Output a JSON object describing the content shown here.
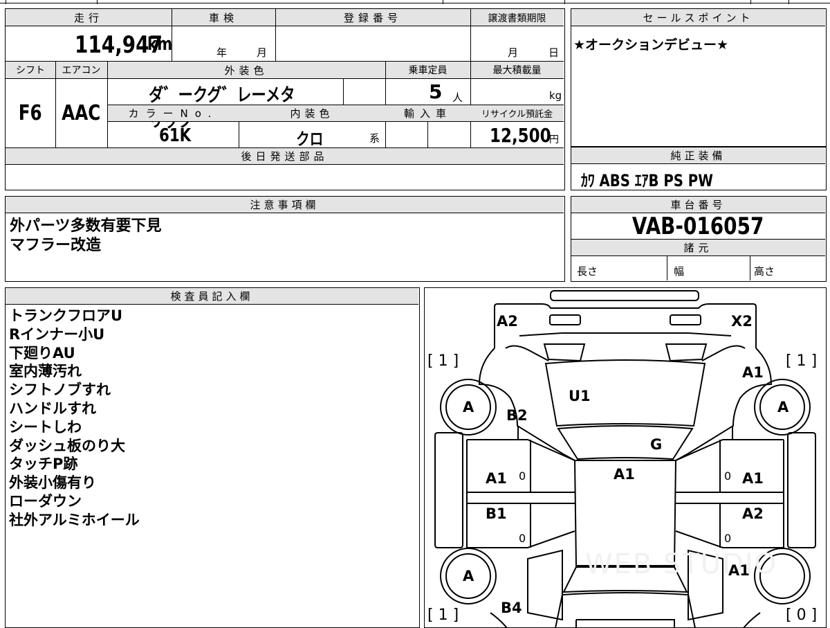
{
  "info": {
    "mileage_label": "走行",
    "mileage_value": "114,947",
    "mileage_unit": "km",
    "inspection_label": "車検",
    "inspection_year": "年",
    "inspection_month": "月",
    "registration_label": "登録番号",
    "transfer_label": "譲渡書類期限",
    "transfer_month": "月",
    "transfer_day": "日",
    "shift_label": "シフト",
    "shift_value": "F6",
    "aircon_label": "エアコン",
    "aircon_value": "AAC",
    "exterior_color_label": "外装色",
    "exterior_color_value": "ダ゛ークグ゛レーメタリック",
    "capacity_label": "乗車定員",
    "capacity_value": "5",
    "capacity_unit": "人",
    "max_load_label": "最大積載量",
    "max_load_unit": "kg",
    "color_no_label": "カラーNo.",
    "color_no_value": "61K",
    "interior_color_label": "内装色",
    "interior_color_value": "クロ",
    "interior_color_suffix": "系",
    "import_label": "輸入車",
    "recycle_label": "リサイクル預託金",
    "recycle_value": "12,500",
    "recycle_unit": "円",
    "later_parts_label": "後日発送部品"
  },
  "sales_point": {
    "label": "セールスポイント",
    "text": "★オークションデビュー★"
  },
  "equipment": {
    "label": "純正装備",
    "text": "ｶﾜ ABS ｴｱB PS PW"
  },
  "caution": {
    "label": "注意事項欄",
    "lines": [
      "外パーツ多数有要下見",
      "マフラー改造"
    ]
  },
  "chassis": {
    "label": "車台番号",
    "value": "VAB-016057"
  },
  "specs": {
    "label": "諸元",
    "length_label": "長さ",
    "width_label": "幅",
    "height_label": "高さ"
  },
  "inspector": {
    "label": "検査員記入欄",
    "lines": [
      "トランクフロアU",
      "Rインナー小U",
      "下廻りAU",
      "室内薄汚れ",
      "シフトノブすれ",
      "ハンドルすれ",
      "シートしわ",
      "ダッシュ板のり大",
      "タッチP跡",
      "外装小傷有り",
      "ローダウン",
      "社外アルミホイール"
    ]
  },
  "diagram": {
    "watermark": "WEB STUDIO",
    "tire_fl_bracket": "[ 1 ]",
    "tire_fr_bracket": "[ 1 ]",
    "tire_rl_bracket": "[ 1 ]",
    "tire_rr_bracket": "[ 0 ]",
    "wheel_fl": "A",
    "wheel_fr": "A",
    "wheel_rl": "A",
    "marks": {
      "a2_rear_left": "A2",
      "x2_rear_right": "X2",
      "u1_trunk": "U1",
      "b2_left_quarter": "B2",
      "a1_right_quarter": "A1",
      "g_rear_glass": "G",
      "a1_roof": "A1",
      "a1_left_rear_door": "A1",
      "a1_right_rear_door": "A1",
      "b1_left_front_door": "B1",
      "a2_right_front_door": "A2",
      "a1_right_fender": "A1",
      "b4_left_fender": "B4",
      "zero_1": "0",
      "zero_2": "0",
      "zero_3": "0",
      "zero_4": "0"
    }
  }
}
